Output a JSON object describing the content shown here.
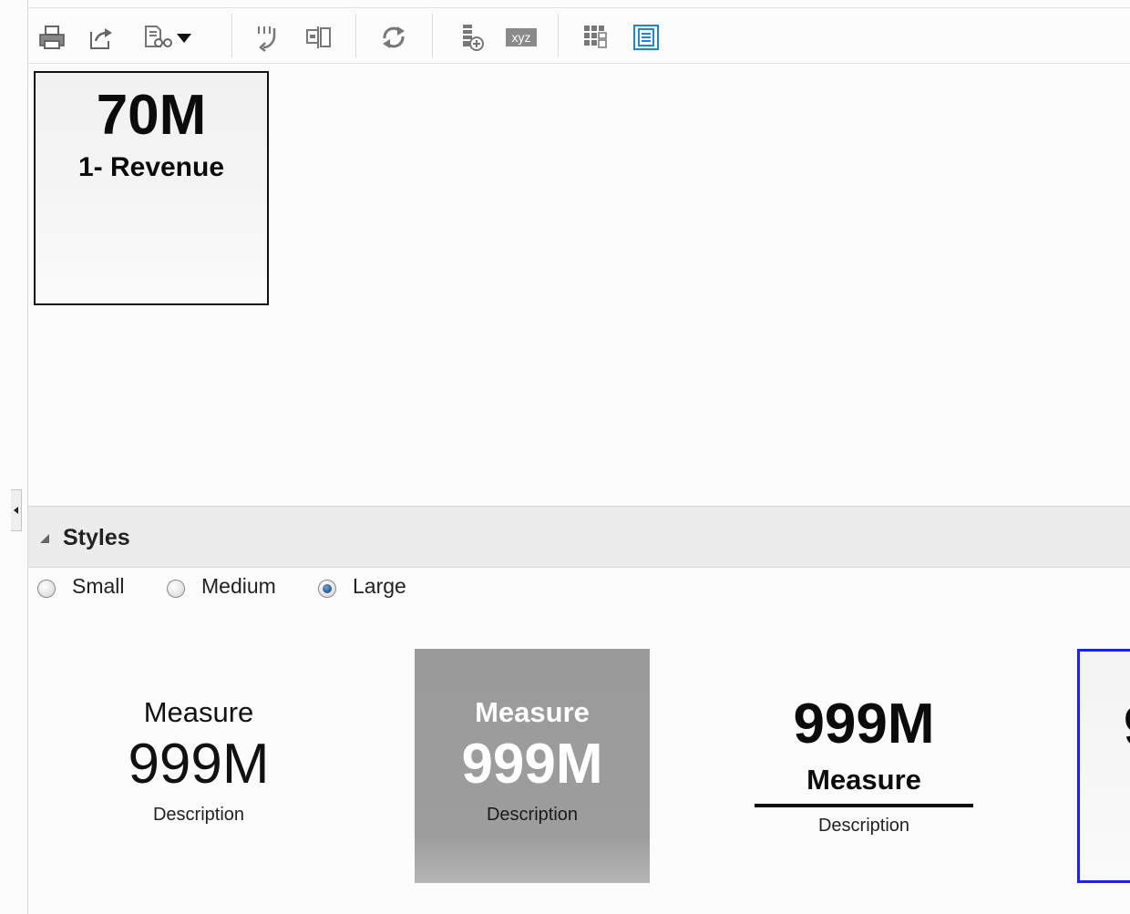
{
  "toolbar": {
    "buttons": [
      {
        "name": "print-icon"
      },
      {
        "name": "export-icon"
      },
      {
        "name": "preview-icon",
        "has_dropdown": true
      },
      {
        "name": "fit-content-icon"
      },
      {
        "name": "swap-icon"
      },
      {
        "name": "refresh-icon"
      },
      {
        "name": "insert-calc-icon"
      },
      {
        "name": "xyz-icon",
        "text": "xyz"
      },
      {
        "name": "grid-icon"
      },
      {
        "name": "tile-view-icon",
        "active_color": "#1e86d0"
      }
    ]
  },
  "canvas": {
    "tile": {
      "value": "70M",
      "label": "1- Revenue"
    }
  },
  "styles": {
    "title": "Styles",
    "sizes": [
      {
        "label": "Small",
        "checked": false
      },
      {
        "label": "Medium",
        "checked": false
      },
      {
        "label": "Large",
        "checked": true
      }
    ],
    "previews": [
      {
        "measure": "Measure",
        "value": "999M",
        "description": "Description"
      },
      {
        "measure": "Measure",
        "value": "999M",
        "description": "Description"
      },
      {
        "measure": "Measure",
        "value": "999M",
        "description": "Description"
      },
      {
        "value": "9"
      }
    ]
  },
  "colors": {
    "selection_border": "#1a27d6",
    "preview_gray": "#9d9d9d"
  }
}
